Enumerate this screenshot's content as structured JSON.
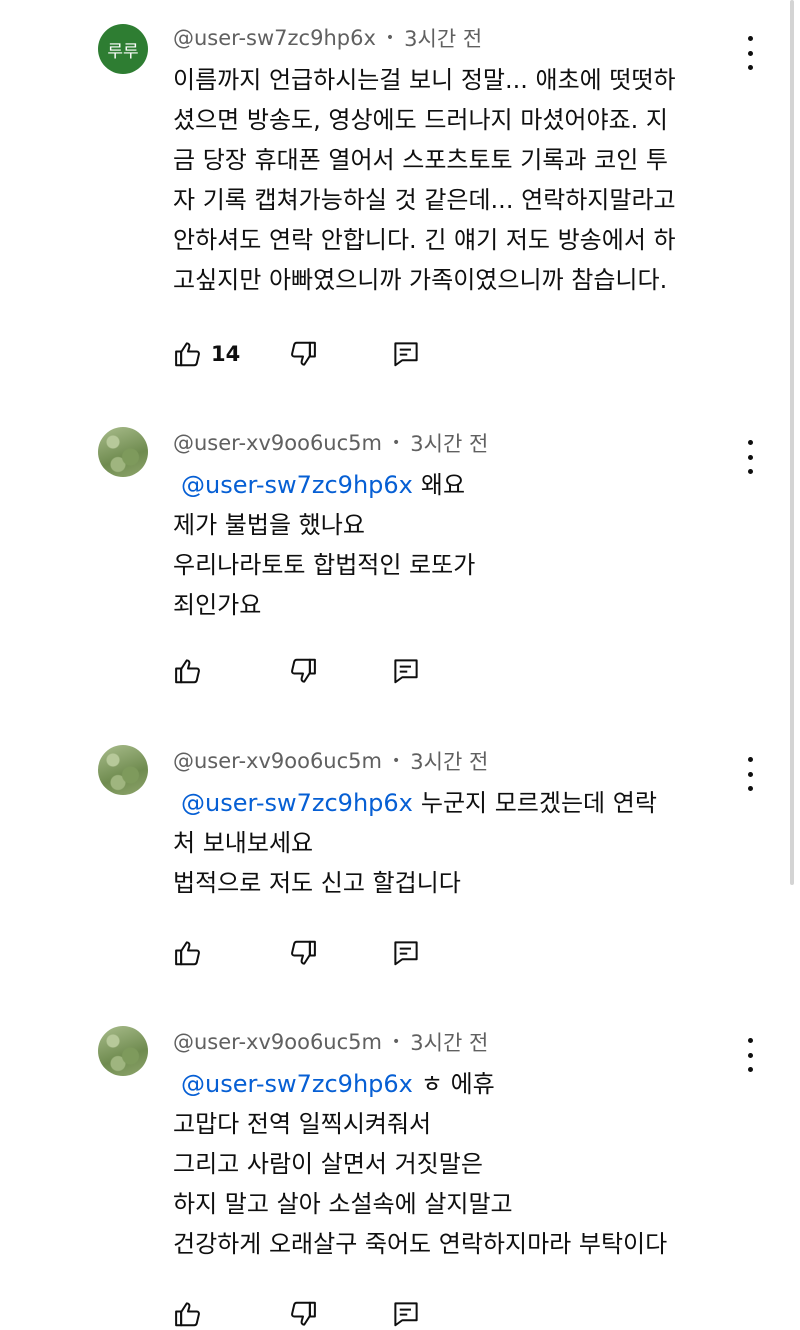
{
  "comments": [
    {
      "avatar_text": "루루",
      "author": "@user-sw7zc9hp6x",
      "time": "3시간 전",
      "mention": "",
      "lines": [
        "이름까지 언급하시는걸 보니 정말... 애초에 떳떳하",
        "셨으면 방송도, 영상에도 드러나지 마셨어야죠. 지",
        "금 당장  휴대폰 열어서 스포츠토토 기록과 코인 투",
        "자 기록 캡쳐가능하실 것 같은데... 연락하지말라고",
        "안하셔도 연락 안합니다. 긴 얘기 저도 방송에서 하",
        "고싶지만 아빠였으니까 가족이였으니까 참습니다."
      ],
      "likes": "14"
    },
    {
      "avatar_text": "",
      "author": "@user-xv9oo6uc5m",
      "time": "3시간 전",
      "mention": "@user-sw7zc9hp6x",
      "lines": [
        "왜요",
        "제가 불법을 했나요",
        "우리나라토토 합법적인 로또가",
        "죄인가요"
      ],
      "likes": ""
    },
    {
      "avatar_text": "",
      "author": "@user-xv9oo6uc5m",
      "time": "3시간 전",
      "mention": "@user-sw7zc9hp6x",
      "lines": [
        "누군지 모르겠는데 연락",
        "처 보내보세요",
        "법적으로 저도 신고 할겁니다"
      ],
      "likes": ""
    },
    {
      "avatar_text": "",
      "author": "@user-xv9oo6uc5m",
      "time": "3시간 전",
      "mention": "@user-sw7zc9hp6x",
      "lines": [
        "ㅎ 에휴",
        "고맙다 전역 일찍시켜줘서",
        "그리고 사람이 살면서 거짓말은",
        "하지 말고 살아  소설속에 살지말고",
        "건강하게 오래살구  죽어도 연락하지마라  부탁이다"
      ],
      "likes": ""
    }
  ],
  "icons": {
    "like": "thumbs-up-icon",
    "dislike": "thumbs-down-icon",
    "reply": "reply-icon",
    "menu": "more-vert-icon"
  },
  "colors": {
    "mention": "#065fd4",
    "meta_text": "#606060",
    "avatar_green": "#2e7d32"
  }
}
